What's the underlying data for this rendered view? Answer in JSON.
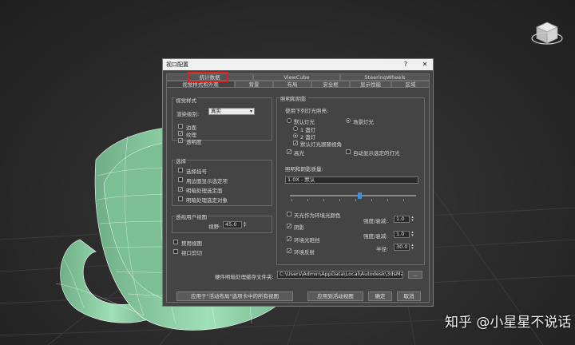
{
  "dialog": {
    "title": "视口配置",
    "help_label": "?",
    "close_label": "✕",
    "tabs_row1": [
      {
        "label": "统计数据"
      },
      {
        "label": "ViewCube"
      },
      {
        "label": "SteeringWheels"
      }
    ],
    "tabs_row2": [
      {
        "label": "视觉样式和外观"
      },
      {
        "label": "背景"
      },
      {
        "label": "布局"
      },
      {
        "label": "安全框"
      },
      {
        "label": "显示性能"
      },
      {
        "label": "区域"
      }
    ]
  },
  "visual_style": {
    "group_label": "视觉样式",
    "render_level_label": "渲染级别:",
    "render_level_value": "真实",
    "edge_faces": {
      "label": "边面",
      "checked": false
    },
    "textures": {
      "label": "纹理",
      "checked": true
    },
    "transparency": {
      "label": "透明度",
      "checked": true
    }
  },
  "selection": {
    "group_label": "选择",
    "selection_brackets": {
      "label": "选择括号",
      "checked": false
    },
    "edge_faces_selected": {
      "label": "用边面显示选定项",
      "checked": false
    },
    "shade_selected_faces": {
      "label": "明暗处理选定面",
      "checked": true
    },
    "shade_selected_objects": {
      "label": "明暗处理选定对象",
      "checked": false
    }
  },
  "perspective": {
    "group_label": "透视用户视图",
    "fov_label": "视野:",
    "fov_value": "45.0"
  },
  "disable_view": {
    "label": "禁用视图",
    "checked": false
  },
  "viewport_clipping": {
    "label": "视口剪切",
    "checked": false
  },
  "lighting": {
    "group_label": "照明和阴影",
    "illuminate_label": "使用下列灯光照亮:",
    "default_lights": {
      "label": "默认灯光",
      "selected": false
    },
    "one_light": {
      "label": "1 盏灯",
      "selected": false
    },
    "two_lights": {
      "label": "2 盏灯",
      "selected": true
    },
    "default_follows_view": {
      "label": "默认灯光跟随视角",
      "checked": true
    },
    "scene_lights": {
      "label": "场景灯光",
      "selected": true
    },
    "highlights": {
      "label": "高光",
      "checked": true
    },
    "auto_display_selected": {
      "label": "自动显示选定的灯光",
      "checked": false
    },
    "quality_label": "照明和阴影质量:",
    "quality_value": "1.0X - 默认",
    "quality_level": 0.55,
    "sky_ambient": {
      "label": "天光作为环境光颜色",
      "checked": false
    },
    "shadows": {
      "label": "阴影",
      "checked": true
    },
    "intensity_fade_label_1": "强度/衰减:",
    "intensity_fade_value_1": "1.0",
    "ambient_occlusion": {
      "label": "环境光阻挡",
      "checked": true
    },
    "intensity_fade_label_2": "强度/衰减:",
    "intensity_fade_value_2": "1.0",
    "radius_label": "半径:",
    "radius_value": "30.0",
    "reflections": {
      "label": "环境反射",
      "checked": true
    }
  },
  "cache": {
    "label": "硬件明暗处理缓存文件夹:",
    "path_value": "C:\\Users\\Admin\\AppData\\Local\\Autodesk\\3dsMax\\2",
    "browse_label": "..."
  },
  "footer": {
    "apply_all_label": "应用于\"活动布局\"选项卡中的所有视图",
    "apply_active_label": "应用到活动视图",
    "ok_label": "确定",
    "cancel_label": "取消"
  },
  "watermark": "知乎 @小星星不说话",
  "colors": {
    "highlight_box": "#e02020",
    "slider_thumb": "#3f8ed8",
    "teapot": "#8fd6a6"
  }
}
